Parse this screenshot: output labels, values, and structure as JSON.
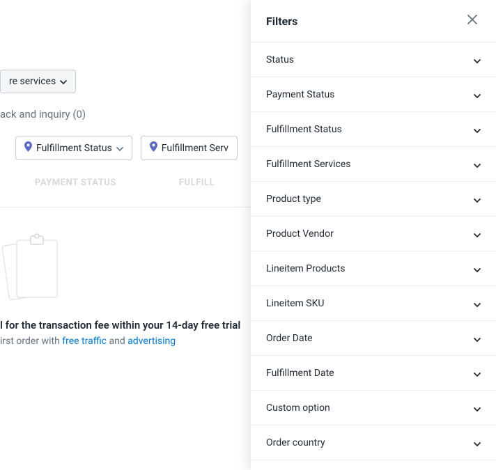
{
  "background": {
    "more_services_label": "re services",
    "tab_label": "ack and inquiry (0)",
    "chips": {
      "fulfillment_status": "Fulfillment Status",
      "fulfillment_services": "Fulfillment Serv"
    },
    "columns": {
      "payment_status": "PAYMENT STATUS",
      "fulfillment": "FULFILL"
    },
    "empty_title": "l for the transaction fee within your 14-day free trial",
    "empty_sub_prefix": "irst order with ",
    "empty_link1": "free traffic",
    "empty_and": " and ",
    "empty_link2": "advertising"
  },
  "filters": {
    "title": "Filters",
    "items": [
      {
        "label": "Status"
      },
      {
        "label": "Payment Status"
      },
      {
        "label": "Fulfillment Status"
      },
      {
        "label": "Fulfillment Services"
      },
      {
        "label": "Product type"
      },
      {
        "label": "Product Vendor"
      },
      {
        "label": "Lineitem Products"
      },
      {
        "label": "Lineitem SKU"
      },
      {
        "label": "Order Date"
      },
      {
        "label": "Fulfillment Date"
      },
      {
        "label": "Custom option"
      },
      {
        "label": "Order country"
      }
    ]
  }
}
